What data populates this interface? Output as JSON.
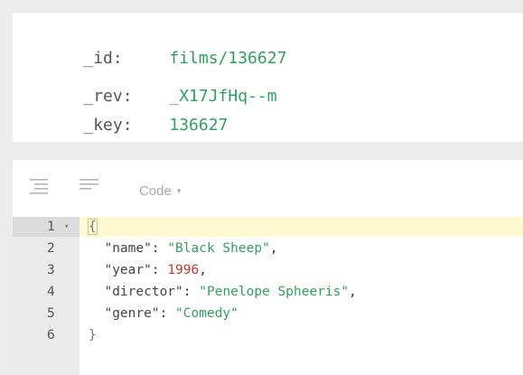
{
  "meta": {
    "rows": [
      {
        "key": "_id:",
        "value": "films/136627"
      },
      {
        "key": "_rev:",
        "value": "_X17JfHq--m"
      },
      {
        "key": "_key:",
        "value": "136627"
      }
    ]
  },
  "toolbar": {
    "format_icon": "indent-lines-icon",
    "compact_icon": "compact-lines-icon",
    "mode_label": "Code",
    "mode_caret": "▾"
  },
  "editor": {
    "line_numbers": [
      "1",
      "2",
      "3",
      "4",
      "5",
      "6"
    ],
    "fold_marker": "▾",
    "open_brace": "{",
    "close_brace": "}",
    "fields": [
      {
        "key": "\"name\"",
        "value": "\"Black Sheep\"",
        "type": "string"
      },
      {
        "key": "\"year\"",
        "value": "1996",
        "type": "number"
      },
      {
        "key": "\"director\"",
        "value": "\"Penelope Spheeris\"",
        "type": "string"
      },
      {
        "key": "\"genre\"",
        "value": "\"Comedy\"",
        "type": "string"
      }
    ],
    "colors": {
      "string": "#2fa15e",
      "number": "#c0392b",
      "active_line": "#fffad1"
    }
  }
}
